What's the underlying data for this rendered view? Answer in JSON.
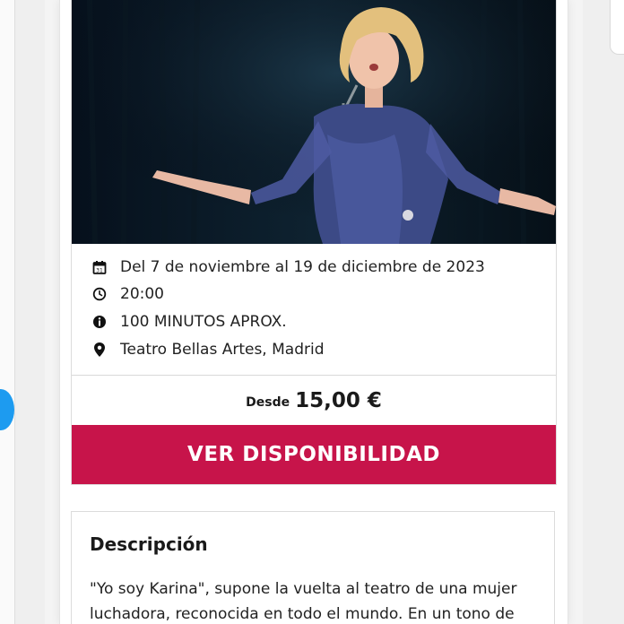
{
  "event": {
    "hero_image_alt": "Singer in blue dress on stage with microphone",
    "date_text": "Del 7 de noviembre al 19 de diciembre de 2023",
    "time_text": "20:00",
    "duration_text": "100 MINUTOS APROX.",
    "venue_text": "Teatro Bellas Artes, Madrid"
  },
  "pricing": {
    "from_label": "Desde",
    "price": "15,00 €"
  },
  "cta": {
    "label": "VER DISPONIBILIDAD"
  },
  "description": {
    "title": "Descripción",
    "text": "\"Yo soy Karina\", supone la vuelta al teatro de una mujer luchadora, reconocida en todo el mundo. En un tono de"
  },
  "colors": {
    "accent": "#c7144a",
    "side_button": "#1d9bf0"
  },
  "icons": {
    "date": "calendar-icon",
    "time": "clock-icon",
    "duration": "info-icon",
    "venue": "location-pin-icon"
  }
}
